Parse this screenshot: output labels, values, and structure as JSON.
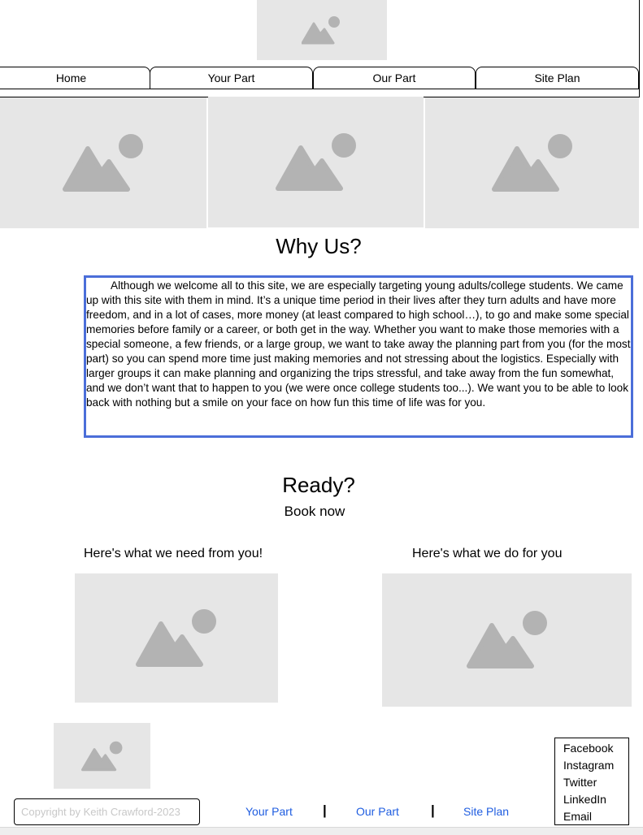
{
  "nav": {
    "items": [
      {
        "label": "Home"
      },
      {
        "label": "Your Part"
      },
      {
        "label": "Our Part"
      },
      {
        "label": "Site Plan"
      }
    ]
  },
  "why": {
    "heading": "Why Us?",
    "paragraph": "Although we welcome all to this site, we are especially targeting young adults/college students. We came up with this site with them in mind. It’s a unique time period in their lives after they turn adults and have more freedom, and in a lot of cases, more money (at least compared to high school…), to go and make some special memories before family or a career, or both get in the way. Whether you want to make those memories with a special someone, a few friends, or a large group, we want to take away the planning part from you (for the most part) so you can spend more time just making memories and not stressing about the logistics. Especially with larger groups it can make planning and organizing the trips stressful, and take away from the fun somewhat, and we don’t want that to happen to you (we were once college students too...). We want you to be able to look back with nothing but a smile on your face on how fun this time of life was for you."
  },
  "ready": {
    "heading": "Ready?",
    "book_label": "Book now"
  },
  "columns": {
    "left_title": "Here's what we need from you!",
    "right_title": "Here's what we do for you"
  },
  "footer": {
    "copyright": "Copyright by Keith Crawford-2023",
    "links": [
      {
        "label": "Your Part"
      },
      {
        "label": "Our Part"
      },
      {
        "label": "Site Plan"
      }
    ],
    "separator": "|",
    "social": [
      {
        "label": "Facebook"
      },
      {
        "label": "Instagram"
      },
      {
        "label": "Twitter"
      },
      {
        "label": "LinkedIn"
      },
      {
        "label": "Email"
      }
    ]
  },
  "colors": {
    "placeholder_bg": "#e6e6e6",
    "placeholder_icon": "#b3b3b3",
    "accent_border": "#4b6ed9",
    "link": "#1f5de0"
  }
}
